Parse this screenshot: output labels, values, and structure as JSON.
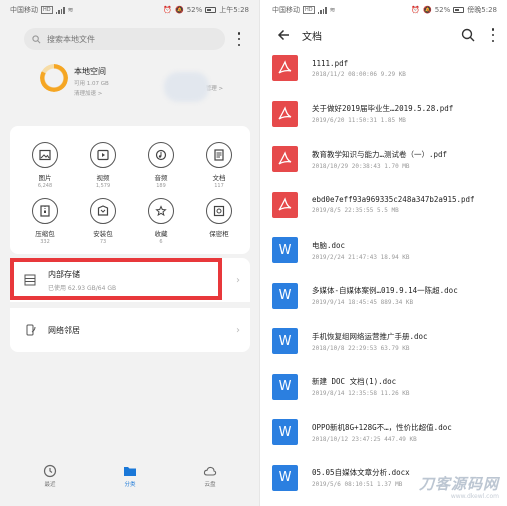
{
  "status": {
    "carrier": "中国移动",
    "hd_tag": "HD",
    "battery": "52%",
    "time_left": "上午5:28",
    "time_right": "傍晚5:28"
  },
  "left": {
    "search_placeholder": "搜索本地文件",
    "storage": [
      {
        "title": "本地空间",
        "sub1": "可用 1.07 GB",
        "sub2": "清理加速 >",
        "used_fraction": 0.83
      },
      {
        "title": "",
        "sub1": "",
        "sub2": "上传管理 >"
      }
    ],
    "categories": [
      {
        "label": "图片",
        "count": "6,248",
        "icon": "image-icon"
      },
      {
        "label": "视频",
        "count": "1,579",
        "icon": "video-icon"
      },
      {
        "label": "音频",
        "count": "189",
        "icon": "audio-icon"
      },
      {
        "label": "文档",
        "count": "117",
        "icon": "document-icon"
      },
      {
        "label": "压缩包",
        "count": "332",
        "icon": "archive-icon"
      },
      {
        "label": "安装包",
        "count": "73",
        "icon": "package-icon"
      },
      {
        "label": "收藏",
        "count": "6",
        "icon": "star-icon"
      },
      {
        "label": "保密柜",
        "count": "",
        "icon": "safe-icon"
      }
    ],
    "internal_storage": {
      "title": "内部存储",
      "sub": "已使用 62.93 GB/64 GB"
    },
    "network": {
      "title": "网络邻居"
    },
    "nav": [
      {
        "label": "最近",
        "icon": "clock-icon"
      },
      {
        "label": "分类",
        "icon": "folder-icon"
      },
      {
        "label": "云盘",
        "icon": "cloud-icon"
      }
    ],
    "colors": {
      "accent": "#1a78d8",
      "ring": "#f5a623",
      "highlight": "#e8383b"
    }
  },
  "right": {
    "title": "文档",
    "files": [
      {
        "type": "pdf",
        "name": "1111.pdf",
        "meta": "2018/11/2 08:00:06 9.29 KB"
      },
      {
        "type": "pdf",
        "name": "关于做好2019届毕业生…2019.5.28.pdf",
        "meta": "2019/6/20 11:50:31 1.85 MB"
      },
      {
        "type": "pdf",
        "name": "教育教学知识与能力…测试卷（一）.pdf",
        "meta": "2018/10/29 20:38:43 1.70 MB"
      },
      {
        "type": "pdf",
        "name": "ebd0e7eff93a969335c248a347b2a915.pdf",
        "meta": "2019/8/5 22:35:55 5.5 MB"
      },
      {
        "type": "doc",
        "name": "电脑.doc",
        "meta": "2019/2/24 21:47:43 18.94 KB"
      },
      {
        "type": "doc",
        "name": "多媒体-自媒体案例…019.9.14一陈超.doc",
        "meta": "2019/9/14 18:45:45 889.34 KB"
      },
      {
        "type": "doc",
        "name": "手机恢复组网络运营推广手册.doc",
        "meta": "2018/10/8 22:29:53 63.79 KB"
      },
      {
        "type": "doc",
        "name": "新建 DOC 文档(1).doc",
        "meta": "2019/8/14 12:35:58 11.26 KB"
      },
      {
        "type": "doc",
        "name": "OPPO新机8G+128G不…，性价比超值.doc",
        "meta": "2018/10/12 23:47:25 447.49 KB"
      },
      {
        "type": "doc",
        "name": "05.05自媒体文章分析.docx",
        "meta": "2019/5/6 08:10:51 1.37 MB"
      }
    ],
    "doc_icon_letter": "W",
    "colors": {
      "pdf": "#e64a4b",
      "doc": "#2b7fe0"
    }
  },
  "watermark": {
    "line1": "刀客源码网",
    "line2": "www.dkewl.com"
  }
}
